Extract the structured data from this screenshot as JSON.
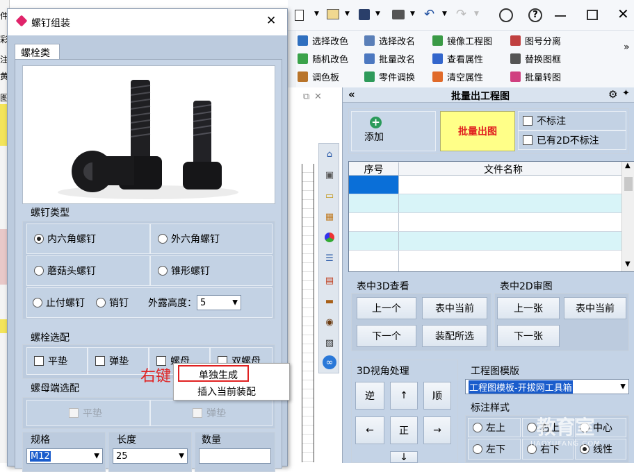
{
  "left_strip": [
    "件",
    "彩",
    "注",
    "黄",
    "图"
  ],
  "toolbar": {
    "row1": [
      {
        "label": "选择改色",
        "icon": "select-color-icon",
        "color": "#2f6fbf"
      },
      {
        "label": "选择改名",
        "icon": "select-rename-icon",
        "color": "#5a7fb8"
      },
      {
        "label": "镜像工程图",
        "icon": "mirror-drawing-icon",
        "color": "#3a9a46"
      },
      {
        "label": "图号分离",
        "icon": "split-number-icon",
        "color": "#c04040"
      }
    ],
    "row2": [
      {
        "label": "随机改色",
        "icon": "random-color-icon",
        "color": "#3aa24a"
      },
      {
        "label": "批量改名",
        "icon": "batch-rename-icon",
        "color": "#4c78c0"
      },
      {
        "label": "查看属性",
        "icon": "view-properties-icon",
        "color": "#3366cc"
      },
      {
        "label": "替换图框",
        "icon": "replace-frame-icon",
        "color": "#555555"
      }
    ],
    "row3": [
      {
        "label": "调色板",
        "icon": "palette-icon",
        "color": "#b8742a"
      },
      {
        "label": "零件调换",
        "icon": "swap-part-icon",
        "color": "#2e9a5a"
      },
      {
        "label": "清空属性",
        "icon": "clear-properties-icon",
        "color": "#e06a2a"
      },
      {
        "label": "批量转图",
        "icon": "batch-convert-icon",
        "color": "#d04080"
      }
    ],
    "more": "»"
  },
  "dialog": {
    "title": "螺钉组装",
    "close": "✕",
    "tab": "螺栓类",
    "screw_type": {
      "legend": "螺钉类型",
      "options": [
        "内六角螺钉",
        "外六角螺钉",
        "蘑菇头螺钉",
        "锥形螺钉",
        "止付螺钉",
        "销钉"
      ],
      "selected": "内六角螺钉",
      "exposed_label": "外露高度：",
      "exposed_value": "5"
    },
    "bolt_options": {
      "legend": "螺栓选配",
      "items": [
        "平垫",
        "弹垫",
        "螺母",
        "双螺母"
      ]
    },
    "nut_options": {
      "legend": "螺母端选配",
      "items": [
        "平垫",
        "弹垫"
      ]
    },
    "spec": {
      "label": "规格",
      "value": "M12"
    },
    "length": {
      "label": "长度",
      "value": "25"
    },
    "qty": {
      "label": "数量",
      "value": ""
    }
  },
  "annotation": {
    "text": "右键",
    "color": "#e02020"
  },
  "context_menu": {
    "items": [
      "单独生成",
      "插入当前装配"
    ]
  },
  "panel": {
    "title": "批量出工程图",
    "collapse": "«",
    "add_label": "添加",
    "batch_button": "批量出图",
    "no_mark": "不标注",
    "no_mark_2d": "已有2D不标注",
    "table_headers": [
      "序号",
      "文件名称"
    ],
    "view3d": {
      "legend": "表中3D查看",
      "prev": "上一个",
      "current": "表中当前",
      "next": "下一个",
      "assembly": "装配所选"
    },
    "view2d": {
      "legend": "表中2D审图",
      "prev": "上一张",
      "current": "表中当前",
      "next": "下一张"
    },
    "view_angle": {
      "legend": "3D视角处理",
      "reverse": "逆",
      "forward": "顺",
      "center": "正",
      "up": "↑",
      "down": "↓",
      "left": "←",
      "right": "→"
    },
    "template": {
      "legend": "工程图模版",
      "value": "工程图模板-开拔网工具箱"
    },
    "mark_style": {
      "legend": "标注样式",
      "options": [
        "左上",
        "右上",
        "中心",
        "左下",
        "右下",
        "线性"
      ],
      "selected": "线性"
    }
  },
  "watermark": {
    "line1": "教育室",
    "line2": "JIAOYUFANG.COM"
  }
}
